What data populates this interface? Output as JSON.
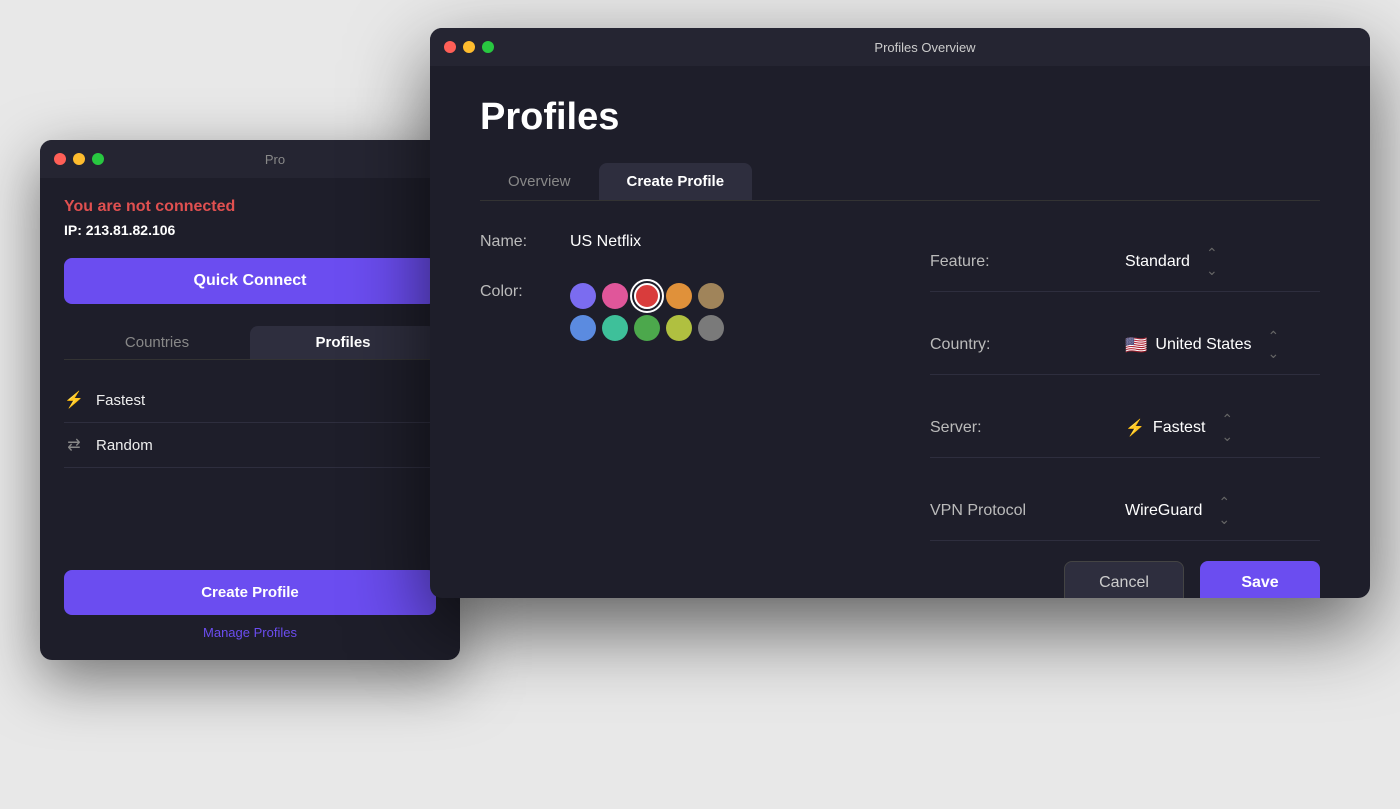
{
  "back_window": {
    "title": "Pro",
    "connection_status": "You are not connected",
    "ip_label": "IP:",
    "ip_value": "213.81.82.106",
    "quick_connect_label": "Quick Connect",
    "tabs": [
      {
        "label": "Countries",
        "active": false
      },
      {
        "label": "Profiles",
        "active": true
      }
    ],
    "profiles": [
      {
        "icon": "bolt",
        "name": "Fastest"
      },
      {
        "icon": "shuffle",
        "name": "Random"
      }
    ],
    "create_profile_label": "Create Profile",
    "manage_profiles_label": "Manage Profiles"
  },
  "front_window": {
    "title": "Profiles Overview",
    "page_title": "Profiles",
    "tabs": [
      {
        "label": "Overview",
        "active": false
      },
      {
        "label": "Create Profile",
        "active": true
      }
    ],
    "form": {
      "name_label": "Name:",
      "name_value": "US Netflix",
      "color_label": "Color:",
      "colors": [
        {
          "hex": "#7b6cf0",
          "selected": false
        },
        {
          "hex": "#e0569a",
          "selected": false
        },
        {
          "hex": "#d93c3c",
          "selected": true
        },
        {
          "hex": "#e0913a",
          "selected": false
        },
        {
          "hex": "#a0845a",
          "selected": false
        },
        {
          "hex": "#5b8be0",
          "selected": false
        },
        {
          "hex": "#3ec09a",
          "selected": false
        },
        {
          "hex": "#4ca84c",
          "selected": false
        },
        {
          "hex": "#b0c040",
          "selected": false
        },
        {
          "hex": "#7a7a7a",
          "selected": false
        }
      ],
      "feature_label": "Feature:",
      "feature_value": "Standard",
      "country_label": "Country:",
      "country_flag": "🇺🇸",
      "country_value": "United States",
      "server_label": "Server:",
      "server_value": "Fastest",
      "vpn_protocol_label": "VPN Protocol",
      "vpn_protocol_value": "WireGuard"
    },
    "cancel_label": "Cancel",
    "save_label": "Save"
  }
}
